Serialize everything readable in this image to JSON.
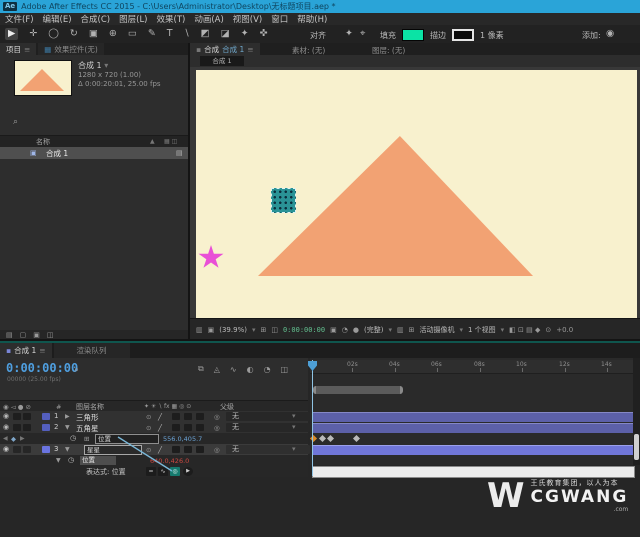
{
  "title_bar": {
    "app_icon": "Ae",
    "title": "Adobe After Effects CC 2015 - C:\\Users\\Administrator\\Desktop\\无标题项目.aep *"
  },
  "menu_bar": {
    "items": [
      "文件(F)",
      "编辑(E)",
      "合成(C)",
      "图层(L)",
      "效果(T)",
      "动画(A)",
      "视图(V)",
      "窗口",
      "帮助(H)"
    ]
  },
  "toolbar": {
    "tools": [
      "▶",
      "✛",
      "◯",
      "↻",
      "▣",
      "⊕",
      "▭",
      "✎",
      "T",
      "∖",
      "◩",
      "◪",
      "✦",
      "✜"
    ],
    "extra_tools": [
      "✦",
      "⌖"
    ],
    "snapping_label": "对齐",
    "fill_label": "填充",
    "fill_color": "#0be3a5",
    "stroke_label": "描边",
    "stroke_width": "1 像素",
    "add_label": "添加:",
    "add_icon": "◉"
  },
  "project_panel": {
    "tab_project": "项目",
    "tab_effects": "效果控件(无)",
    "menu_icon": "≡",
    "panel_icon": "▦",
    "comp_name": "合成 1",
    "comp_caret": "▾",
    "info_line1": "1280 x 720 (1.00)",
    "info_line2": "Δ 0:00:20:01, 25.00 fps",
    "search_icon": "⌕",
    "header_name": "名称",
    "header_sort": "▲",
    "header_icons": "▦ ◫",
    "row_comp": {
      "icon": "▣",
      "name": "合成 1",
      "right_icon": "▤"
    },
    "bottom_icons": [
      "▤",
      "▢",
      "▣",
      "◫"
    ]
  },
  "viewer": {
    "tab_dot": "▪",
    "tab_comp_label": "合成",
    "tab_comp_name": "合成 1",
    "menu_icon": "≡",
    "tab_footage": "素材: (无)",
    "tab_layer": "图层: (无)",
    "nav_tab": "合成 1",
    "toolbar": {
      "icon1": "▥",
      "icon2": "▣",
      "zoom": "(39.9%)",
      "caret": "▾",
      "grid_icon": "⊞",
      "mask_icon": "◫",
      "timecode": "0:00:00:00",
      "snapshot_icon": "▣",
      "show_snapshot_icon": "◔",
      "channels_icon": "●",
      "resolution": "(完整)",
      "roi_icon": "▥",
      "transparency_icon": "⊞",
      "camera": "活动摄像机",
      "views": "1 个视图",
      "right_icons": "◧ ⊡ ▤ ◆",
      "exposure_icon": "⊙",
      "exposure": "+0.0"
    }
  },
  "timeline": {
    "tab_icon": "▪",
    "tab_active": "合成 1",
    "menu_icon": "≡",
    "tab_render": "渲染队列",
    "timecode": "0:00:00:00",
    "frame_info": "00000 (25.00 fps)",
    "search_icon": "⌕",
    "cluster_icons": [
      "⧉",
      "◬",
      "∿",
      "◐",
      "◔",
      "◫"
    ],
    "header": {
      "av_icons": "◉ ◅ ● ⊘",
      "hash": "#",
      "layer_name": "图层名称",
      "switches": "✦ ☀ ∖ fx ▦ ◎ ⊙",
      "parent": "父级"
    },
    "eye_icon": "◉",
    "switch1": "⊙",
    "switch2": "╱",
    "parent_icon": "◎",
    "parent_value": "无",
    "caret": "▾",
    "layers": [
      {
        "num": "1",
        "twirl": "▶",
        "name": "三角形"
      },
      {
        "num": "2",
        "twirl": "▼",
        "name": "五角星"
      },
      {
        "num": "3",
        "twirl": "▼",
        "name": "星星"
      }
    ],
    "kf_prev": "◀",
    "kf_icon": "◆",
    "kf_next": "▶",
    "stopwatch": "◷",
    "aux_icon": "⊞",
    "twirl_down": "▼",
    "position_label": "位置",
    "pos_value_keyframed": "556.0,405.7",
    "pos_value_expression": "640.0,426.0",
    "expression_label": "表达式: 位置",
    "expr_icons": [
      "=",
      "∿",
      "◎",
      "▶"
    ],
    "ruler_labels": [
      "02s",
      "04s",
      "06s",
      "08s",
      "10s",
      "12s",
      "14s"
    ]
  },
  "watermark": {
    "logo": "W",
    "tagline": "王氏教育集团，以人为本",
    "brand": "CGWANG",
    "suffix": ".com"
  },
  "colors": {
    "titlebar": "#2aa4d8",
    "fill_swatch": "#0be3a5",
    "comp_bg": "#f8f1ce",
    "triangle": "#f2a273",
    "star": "#e94fd6",
    "selection_teal": "#2a9396",
    "layer_bar": "#5c60a8",
    "layer_bar_selected": "#7076d8",
    "timecode_blue": "#4f9fe0",
    "viewer_timecode_green": "#63c190",
    "keyframe_value_blue": "#6ba3d6",
    "expression_value_red": "#cc4840",
    "pickwhip_line": "#7ab8d9"
  }
}
